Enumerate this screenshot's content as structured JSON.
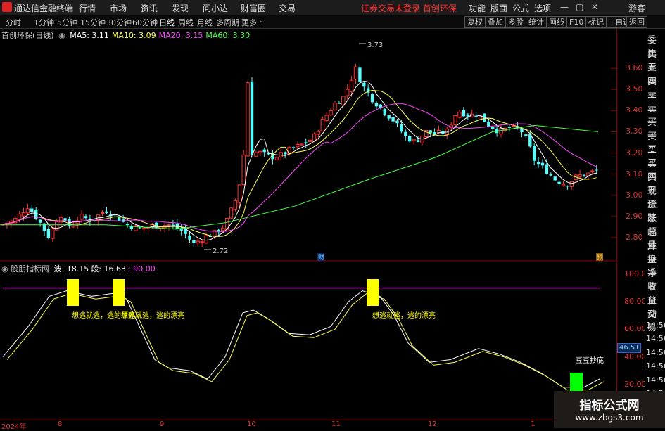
{
  "app": {
    "title": "通达信金融终端",
    "status": "证券交易未登录 首创环保"
  },
  "menu": [
    "行情",
    "市场",
    "资讯",
    "发现",
    "问小达",
    "财富圈",
    "交易"
  ],
  "right_menu": [
    "功能",
    "版面",
    "公式",
    "选项"
  ],
  "window_controls": {
    "min": "—",
    "max": "▢",
    "close": "✕",
    "guest": "游客"
  },
  "periods": [
    "分时",
    "1分钟",
    "5分钟",
    "15分钟",
    "30分钟",
    "60分钟",
    "日线",
    "周线",
    "月线",
    "多周期",
    "更多"
  ],
  "toolbar_right": [
    "复权",
    "叠加",
    "多股",
    "统计",
    "画线",
    "F10",
    "标记",
    "+自选",
    "返回"
  ],
  "sidebar": [
    "委比",
    "卖五",
    "卖四",
    "卖三",
    "卖二",
    "卖一",
    "买一",
    "买二",
    "买三",
    "买四",
    "买五",
    "现价",
    "涨跌",
    "涨幅",
    "总量",
    "外盘",
    "换手",
    "净资",
    "收益",
    "自动",
    "交易",
    "14:56",
    "14:56",
    "14:56",
    "14:56",
    "14:56",
    "14:56",
    "14:56",
    "14:56"
  ],
  "main_chart": {
    "stock": "首创环保(日线)",
    "ma_labels": [
      {
        "text": "MA5: 3.11",
        "color": "#ffffff"
      },
      {
        "text": "MA10: 3.09",
        "color": "#ffff55"
      },
      {
        "text": "MA20: 3.15",
        "color": "#ff44ff"
      },
      {
        "text": "MA60: 3.30",
        "color": "#44ff44"
      }
    ],
    "y_ticks": [
      "3.60",
      "3.50",
      "3.40",
      "3.30",
      "3.20",
      "3.10",
      "3.00",
      "2.90",
      "2.80"
    ],
    "high_label": "3.73",
    "low_label": "2.72",
    "marker_cai": "财",
    "marker_yu": "预"
  },
  "indicator": {
    "name": "股朋指标网",
    "params": [
      {
        "text": "波: 18.15",
        "color": "#ffffff"
      },
      {
        "text": "段: 16.63",
        "color": "#ffffff"
      },
      {
        "text": ": 90.00",
        "color": "#ff44ff"
      }
    ],
    "y_ticks": [
      "100.0",
      "80.00",
      "60.00",
      "40.00",
      "20.00"
    ],
    "current_value": "46.51",
    "signal_texts": [
      "想逃就逃，逃的漂亮",
      "想逃就逃，逃的漂亮",
      "想逃就逃，逃的漂亮"
    ],
    "buy_text": "豆豆抄底"
  },
  "x_labels": [
    "2024年",
    "8",
    "9",
    "10",
    "11",
    "12",
    "1"
  ],
  "watermark": {
    "line1": "指标公式网",
    "line2": "www.zbgs3.com"
  },
  "colors": {
    "up": "#ff3333",
    "down": "#54ffff",
    "ma5": "#ffffff",
    "ma10": "#ffff55",
    "ma20": "#ff44ff",
    "ma60": "#44ff44",
    "signal": "#ffff00",
    "buy": "#00ff00"
  }
}
